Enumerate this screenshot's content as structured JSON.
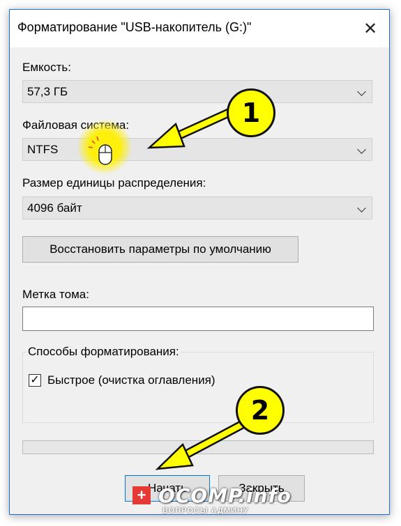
{
  "window": {
    "title": "Форматирование \"USB-накопитель (G:)\"",
    "close_symbol": "✕"
  },
  "capacity": {
    "label": "Емкость:",
    "value": "57,3 ГБ"
  },
  "filesystem": {
    "label": "Файловая система:",
    "value": "NTFS"
  },
  "allocation": {
    "label": "Размер единицы распределения:",
    "value": "4096 байт"
  },
  "restore_defaults_label": "Восстановить параметры по умолчанию",
  "volume_label": {
    "label": "Метка тома:",
    "value": ""
  },
  "format_options": {
    "legend": "Способы форматирования:",
    "quick_label": "Быстрое (очистка оглавления)",
    "quick_checked": true,
    "check_symbol": "✓"
  },
  "progress": {
    "value_percent": 0
  },
  "buttons": {
    "start_label": "Начать",
    "close_label": "Закрыть"
  },
  "annotations": {
    "badge1": "1",
    "badge2": "2",
    "accent_color": "#ffff00",
    "cursor_icon": "mouse-icon"
  },
  "watermark": {
    "plus": "+",
    "brand": "OCOMP.info",
    "tagline": "ВОПРОСЫ АДМИНУ"
  }
}
